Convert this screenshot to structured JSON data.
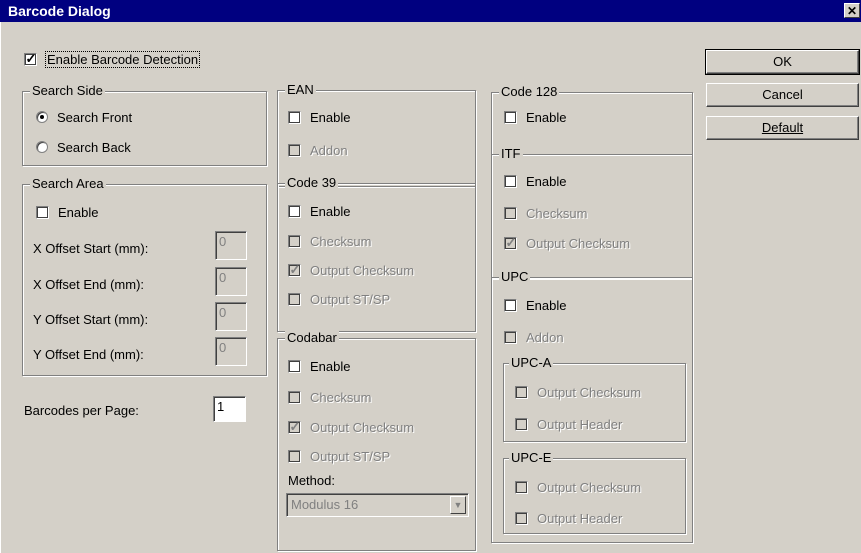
{
  "window": {
    "title": "Barcode Dialog",
    "close_glyph": "✕"
  },
  "enable_detection": {
    "label": "Enable Barcode Detection",
    "checked": true
  },
  "search_side": {
    "legend": "Search Side",
    "front": "Search Front",
    "back": "Search Back",
    "selected": "front"
  },
  "search_area": {
    "legend": "Search Area",
    "enable": "Enable",
    "x_start_label": "X Offset Start (mm):",
    "x_end_label": "X Offset End (mm):",
    "y_start_label": "Y Offset Start (mm):",
    "y_end_label": "Y Offset End (mm):",
    "x_start": "0",
    "x_end": "0",
    "y_start": "0",
    "y_end": "0"
  },
  "barcodes_per_page": {
    "label": "Barcodes per Page:",
    "value": "1"
  },
  "ean": {
    "legend": "EAN",
    "enable": "Enable",
    "addon": "Addon"
  },
  "code39": {
    "legend": "Code 39",
    "enable": "Enable",
    "checksum": "Checksum",
    "output_checksum": "Output Checksum",
    "output_stsp": "Output ST/SP"
  },
  "codabar": {
    "legend": "Codabar",
    "enable": "Enable",
    "checksum": "Checksum",
    "output_checksum": "Output Checksum",
    "output_stsp": "Output ST/SP",
    "method_label": "Method:",
    "method_value": "Modulus 16"
  },
  "code128": {
    "legend": "Code 128",
    "enable": "Enable"
  },
  "itf": {
    "legend": "ITF",
    "enable": "Enable",
    "checksum": "Checksum",
    "output_checksum": "Output Checksum"
  },
  "upc": {
    "legend": "UPC",
    "enable": "Enable",
    "addon": "Addon",
    "upca": {
      "legend": "UPC-A",
      "output_checksum": "Output Checksum",
      "output_header": "Output Header"
    },
    "upce": {
      "legend": "UPC-E",
      "output_checksum": "Output Checksum",
      "output_header": "Output Header"
    }
  },
  "buttons": {
    "ok": "OK",
    "cancel": "Cancel",
    "default": "Default"
  }
}
